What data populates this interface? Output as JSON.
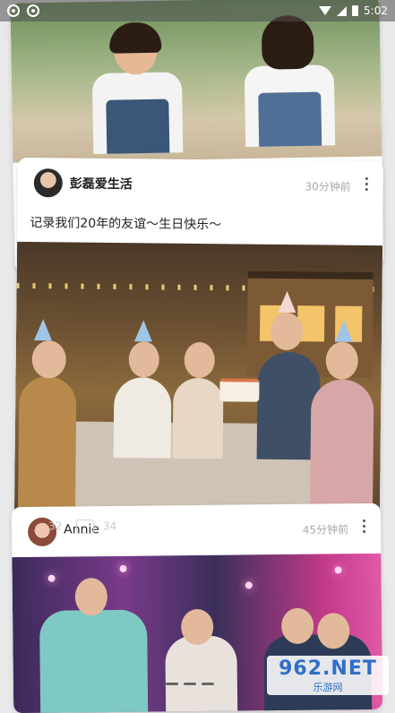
{
  "status_bar": {
    "time": "5:02"
  },
  "posts": [
    {
      "author": "彭磊爱生活",
      "time_ago": "30分钟前",
      "text": "记录我们20年的友谊～生日快乐～"
    },
    {
      "author": "Annie",
      "time_ago": "45分钟前",
      "likes": "32",
      "comments": "34"
    }
  ],
  "watermark": {
    "main": "962.NET",
    "sub": "乐游网"
  },
  "icons": [
    "notification-icon",
    "wifi-icon",
    "signal-icon",
    "battery-icon",
    "more-options-icon",
    "comment-icon"
  ]
}
